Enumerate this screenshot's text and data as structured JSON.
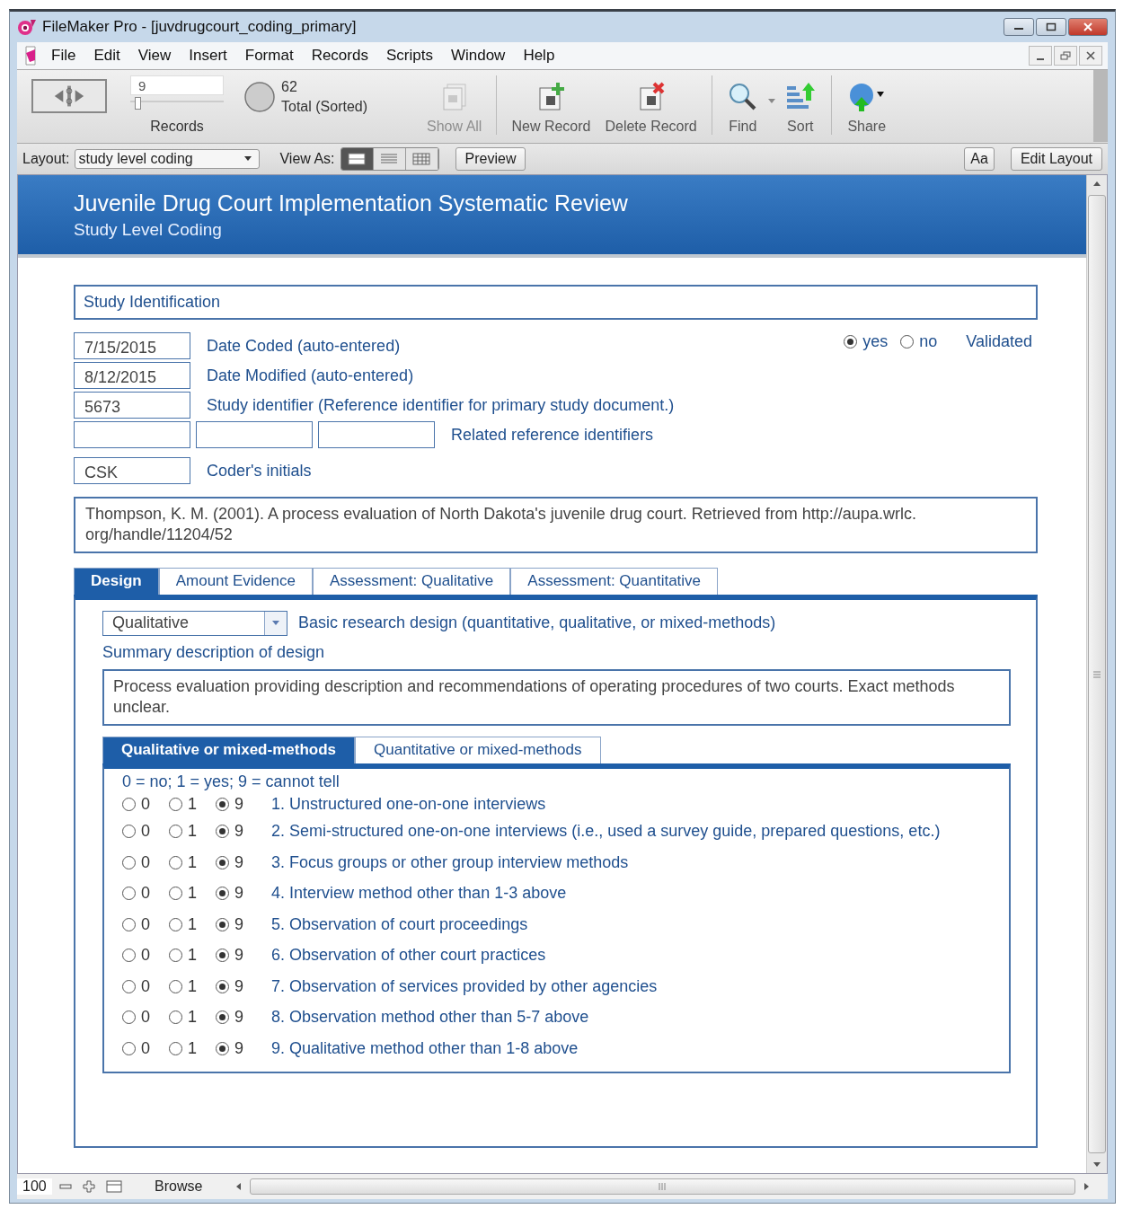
{
  "window": {
    "title": "FileMaker Pro - [juvdrugcourt_coding_primary]"
  },
  "menu": [
    {
      "label": "File"
    },
    {
      "label": "Edit"
    },
    {
      "label": "View"
    },
    {
      "label": "Insert"
    },
    {
      "label": "Format"
    },
    {
      "label": "Records"
    },
    {
      "label": "Scripts"
    },
    {
      "label": "Window"
    },
    {
      "label": "Help"
    }
  ],
  "toolbar": {
    "record_number": "9",
    "record_slider": {
      "level": 0.08
    },
    "records_label": "Records",
    "found_count": "62",
    "found_label": "Total (Sorted)",
    "buttons": [
      {
        "kind": "show-all",
        "label": "Show All",
        "disabled": true
      },
      {
        "kind": "new-record",
        "label": "New Record",
        "disabled": false
      },
      {
        "kind": "delete-record",
        "label": "Delete Record",
        "disabled": false
      },
      {
        "kind": "find",
        "label": "Find",
        "disabled": false
      },
      {
        "kind": "sort",
        "label": "Sort",
        "disabled": false
      },
      {
        "kind": "share",
        "label": "Share",
        "disabled": false
      }
    ]
  },
  "layout_bar": {
    "layout_label": "Layout:",
    "layout_value": "study level coding",
    "view_as_label": "View As:",
    "view_modes": [
      {
        "kind": "form",
        "selected": true
      },
      {
        "kind": "list",
        "selected": false
      },
      {
        "kind": "table",
        "selected": false
      }
    ],
    "preview": "Preview",
    "text_format": "Aa",
    "edit_layout": "Edit Layout"
  },
  "header": {
    "title": "Juvenile Drug Court Implementation Systematic Review",
    "subtitle": "Study Level Coding"
  },
  "section_title": "Study Identification",
  "validated": {
    "options": [
      {
        "label": "yes",
        "selected": true
      },
      {
        "label": "no",
        "selected": false
      }
    ],
    "label": "Validated"
  },
  "fields": [
    {
      "value": "7/15/2015",
      "label": "Date Coded (auto-entered)"
    },
    {
      "value": "8/12/2015",
      "label": "Date Modified (auto-entered)"
    },
    {
      "value": "5673",
      "label": "Study identifier (Reference identifier for primary study document.)"
    }
  ],
  "related_ids": {
    "label": "Related reference identifiers"
  },
  "coder": {
    "value": "CSK",
    "label": "Coder's initials"
  },
  "citation": "Thompson, K. M. (2001). A process evaluation of North Dakota's juvenile drug court. Retrieved from http://aupa.wrlc. org/handle/11204/52",
  "tabs": [
    {
      "label": "Design",
      "selected": true
    },
    {
      "label": "Amount Evidence",
      "selected": false
    },
    {
      "label": "Assessment: Qualitative",
      "selected": false
    },
    {
      "label": "Assessment: Quantitative",
      "selected": false
    }
  ],
  "design": {
    "design_type": "Qualitative",
    "design_label": "Basic research design (quantitative, qualitative, or mixed-methods)",
    "summary_label": "Summary description of design",
    "summary": "Process evaluation providing description and recommendations of operating procedures of two courts. Exact methods unclear."
  },
  "subtabs": [
    {
      "label": "Qualitative or mixed-methods",
      "selected": true
    },
    {
      "label": "Quantitative or mixed-methods",
      "selected": false
    }
  ],
  "legend": "0 = no; 1 = yes; 9 = cannot tell",
  "items": [
    {
      "text": "1. Unstructured one-on-one interviews",
      "options": [
        {
          "label": "0",
          "selected": false
        },
        {
          "label": "1",
          "selected": false
        },
        {
          "label": "9",
          "selected": true
        }
      ]
    },
    {
      "text": "2. Semi-structured one-on-one interviews (i.e., used a survey guide, prepared questions, etc.)",
      "options": [
        {
          "label": "0",
          "selected": false
        },
        {
          "label": "1",
          "selected": false
        },
        {
          "label": "9",
          "selected": true
        }
      ]
    },
    {
      "text": "3. Focus groups or other group interview methods",
      "options": [
        {
          "label": "0",
          "selected": false
        },
        {
          "label": "1",
          "selected": false
        },
        {
          "label": "9",
          "selected": true
        }
      ]
    },
    {
      "text": "4. Interview method other than 1-3 above",
      "options": [
        {
          "label": "0",
          "selected": false
        },
        {
          "label": "1",
          "selected": false
        },
        {
          "label": "9",
          "selected": true
        }
      ]
    },
    {
      "text": "5. Observation of court proceedings",
      "options": [
        {
          "label": "0",
          "selected": false
        },
        {
          "label": "1",
          "selected": false
        },
        {
          "label": "9",
          "selected": true
        }
      ]
    },
    {
      "text": "6. Observation of other court practices",
      "options": [
        {
          "label": "0",
          "selected": false
        },
        {
          "label": "1",
          "selected": false
        },
        {
          "label": "9",
          "selected": true
        }
      ]
    },
    {
      "text": "7. Observation of services provided by other agencies",
      "options": [
        {
          "label": "0",
          "selected": false
        },
        {
          "label": "1",
          "selected": false
        },
        {
          "label": "9",
          "selected": true
        }
      ]
    },
    {
      "text": "8. Observation method other than 5-7 above",
      "options": [
        {
          "label": "0",
          "selected": false
        },
        {
          "label": "1",
          "selected": false
        },
        {
          "label": "9",
          "selected": true
        }
      ]
    },
    {
      "text": "9. Qualitative method other than 1-8 above",
      "options": [
        {
          "label": "0",
          "selected": false
        },
        {
          "label": "1",
          "selected": false
        },
        {
          "label": "9",
          "selected": true
        }
      ]
    }
  ],
  "status_bar": {
    "zoom": "100",
    "mode": "Browse"
  }
}
